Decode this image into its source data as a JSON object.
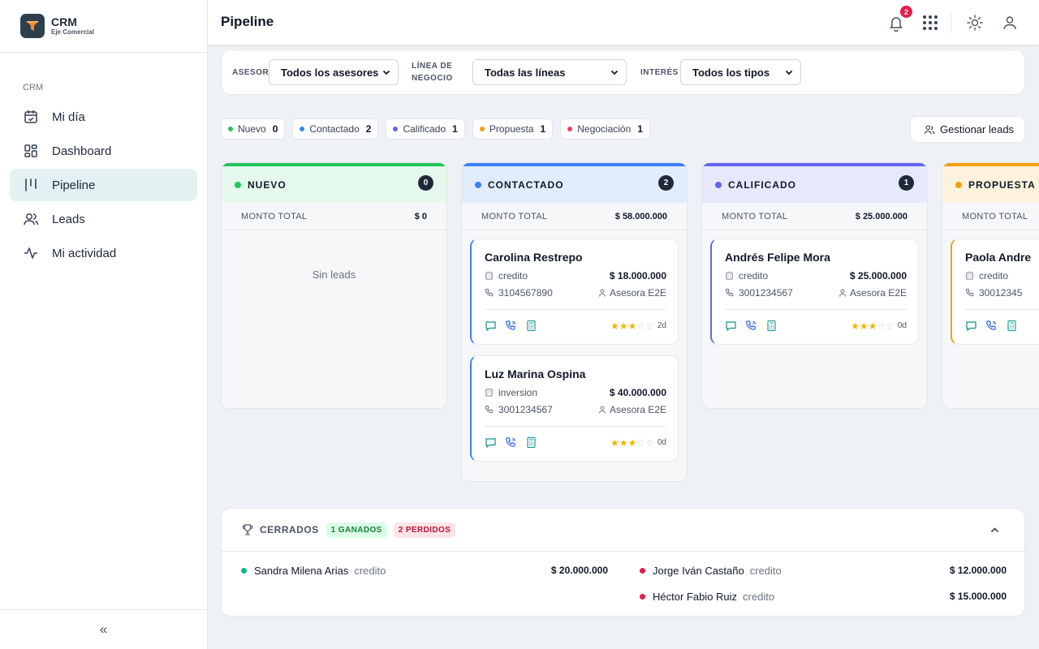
{
  "brand": {
    "title": "CRM",
    "subtitle": "Eje Comercial"
  },
  "sidebar": {
    "section": "CRM",
    "items": [
      {
        "label": "Mi día",
        "icon": "calendar-icon",
        "active": false
      },
      {
        "label": "Dashboard",
        "icon": "dashboard-icon",
        "active": false
      },
      {
        "label": "Pipeline",
        "icon": "pipeline-icon",
        "active": true
      },
      {
        "label": "Leads",
        "icon": "users-icon",
        "active": false
      },
      {
        "label": "Mi actividad",
        "icon": "activity-icon",
        "active": false
      }
    ],
    "collapse_label": "«"
  },
  "header": {
    "title": "Pipeline",
    "notifications_count": "2"
  },
  "filters": {
    "asesor_label": "ASESOR",
    "asesor_value": "Todos los asesores",
    "linea_label_1": "LÍNEA DE",
    "linea_label_2": "NEGOCIO",
    "linea_value": "Todas las líneas",
    "interes_label": "INTERÉS",
    "interes_value": "Todos los tipos"
  },
  "chips": [
    {
      "label": "Nuevo",
      "count": "0",
      "color": "#22c55e"
    },
    {
      "label": "Contactado",
      "count": "2",
      "color": "#3b82f6"
    },
    {
      "label": "Calificado",
      "count": "1",
      "color": "#6366f1"
    },
    {
      "label": "Propuesta",
      "count": "1",
      "color": "#f59e0b"
    },
    {
      "label": "Negociación",
      "count": "1",
      "color": "#f43f5e"
    }
  ],
  "manage_label": "Gestionar leads",
  "total_label": "MONTO TOTAL",
  "empty_label": "Sin leads",
  "columns": [
    {
      "name": "NUEVO",
      "count": "0",
      "total": "$ 0",
      "color": "#22c55e",
      "bg": "#e5f8ec"
    },
    {
      "name": "CONTACTADO",
      "count": "2",
      "total": "$ 58.000.000",
      "color": "#3b82f6",
      "bg": "#e1edfd"
    },
    {
      "name": "CALIFICADO",
      "count": "1",
      "total": "$ 25.000.000",
      "color": "#6366f1",
      "bg": "#e7e8fc"
    },
    {
      "name": "PROPUESTA",
      "count": "",
      "total": "",
      "color": "#f59e0b",
      "bg": "#fdf2dc"
    }
  ],
  "cards": {
    "contactado": [
      {
        "name": "Carolina Restrepo",
        "type": "credito",
        "amount": "$ 18.000.000",
        "phone": "3104567890",
        "advisor": "Asesora E2E",
        "rating": 3,
        "age": "2d"
      },
      {
        "name": "Luz Marina Ospina",
        "type": "inversion",
        "amount": "$ 40.000.000",
        "phone": "3001234567",
        "advisor": "Asesora E2E",
        "rating": 3,
        "age": "0d"
      }
    ],
    "calificado": [
      {
        "name": "Andrés Felipe Mora",
        "type": "credito",
        "amount": "$ 25.000.000",
        "phone": "3001234567",
        "advisor": "Asesora E2E",
        "rating": 3,
        "age": "0d"
      }
    ],
    "propuesta": [
      {
        "name": "Paola Andre",
        "type": "credito",
        "phone": "30012345"
      }
    ]
  },
  "closed": {
    "title": "CERRADOS",
    "won_label": "1 GANADOS",
    "lost_label": "2 PERDIDOS",
    "won": [
      {
        "name": "Sandra Milena Arias",
        "type": "credito",
        "amount": "$ 20.000.000",
        "color": "#10b981"
      }
    ],
    "lost": [
      {
        "name": "Jorge Iván Castaño",
        "type": "credito",
        "amount": "$ 12.000.000",
        "color": "#e11d48"
      },
      {
        "name": "Héctor Fabio Ruiz",
        "type": "credito",
        "amount": "$ 15.000.000",
        "color": "#e11d48"
      }
    ]
  }
}
